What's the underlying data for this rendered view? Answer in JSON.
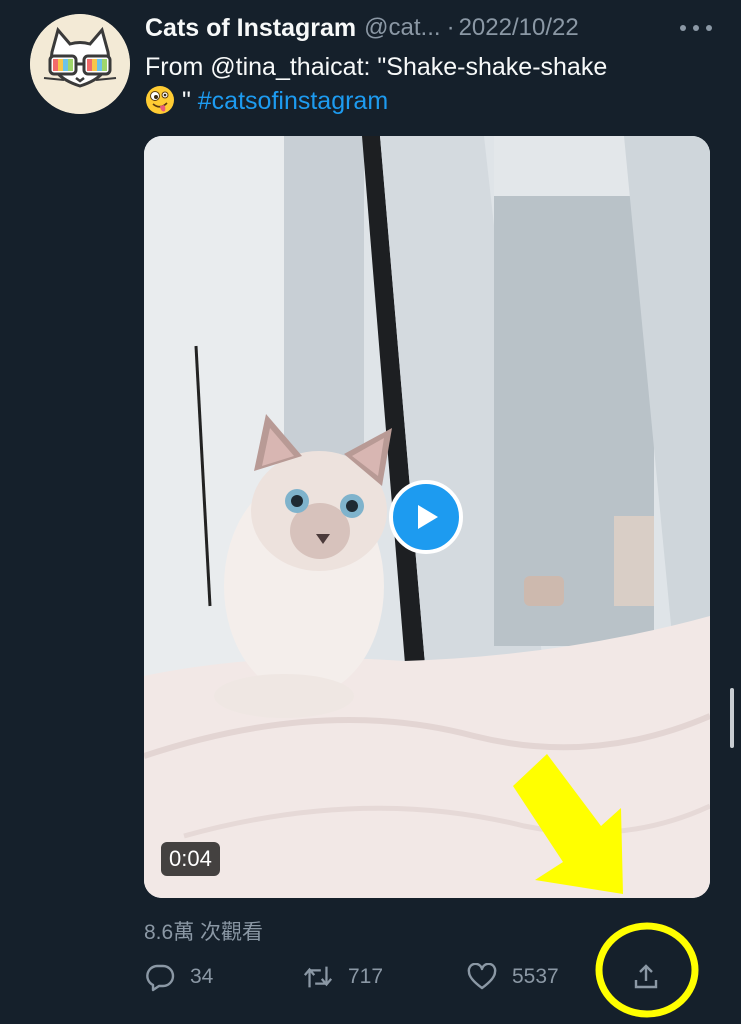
{
  "tweet": {
    "display_name": "Cats of Instagram",
    "handle": "@cat...",
    "separator": "·",
    "date": "2022/10/22",
    "text_line1": "From @tina_thaicat: \"Shake-shake-shake",
    "emoji": "zany-face-emoji",
    "text_quote_close": "\"",
    "hashtag": "#catsofinstagram",
    "views": "8.6萬 次觀看"
  },
  "media": {
    "type": "video",
    "duration": "0:04"
  },
  "actions": {
    "reply_count": "34",
    "retweet_count": "717",
    "like_count": "5537"
  },
  "icons": {
    "more": "more-icon",
    "reply": "reply-icon",
    "retweet": "retweet-icon",
    "like": "like-icon",
    "share": "share-icon",
    "play": "play-icon"
  },
  "colors": {
    "background": "#15202b",
    "accent": "#1d9bf0",
    "muted": "#8b98a5",
    "highlight": "#ffff00"
  }
}
